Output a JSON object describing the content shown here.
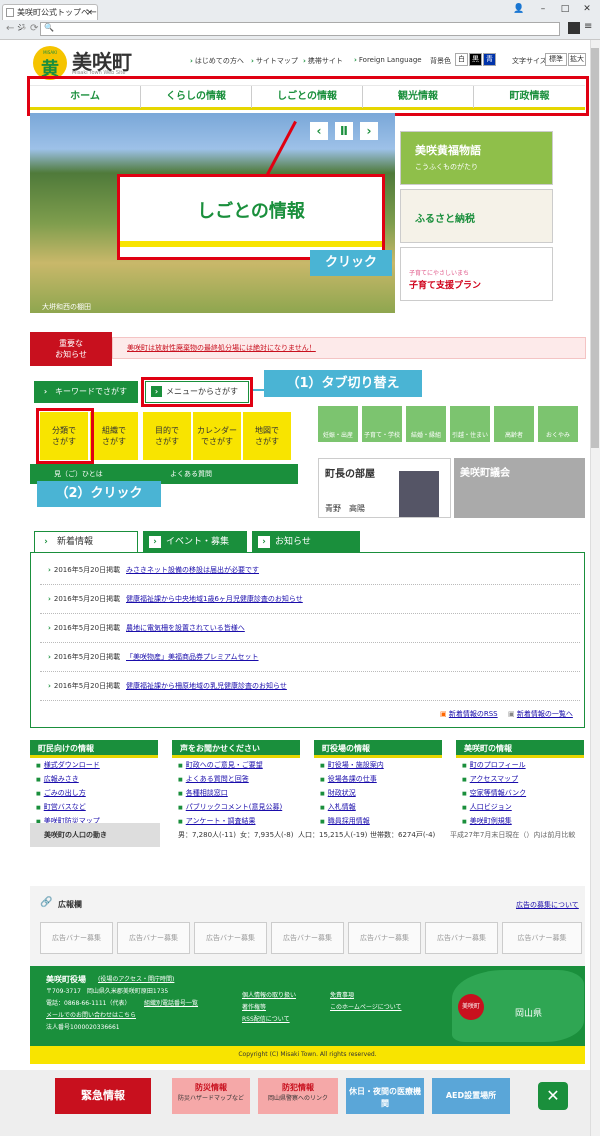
{
  "browser": {
    "tab_title": "美咲町公式トップページ",
    "address": ""
  },
  "header": {
    "logo_mark": "黄",
    "logo_mark_top": "MISAKI",
    "logo_title": "美咲町",
    "logo_sub": "Misaki Town Web Site",
    "util_links": [
      "はじめての方へ",
      "サイトマップ",
      "携帯サイト",
      "Foreign Language"
    ],
    "bg_label": "背景色",
    "bg_options": [
      "白",
      "黒",
      "青"
    ],
    "font_label": "文字サイズ",
    "font_options": [
      "標準",
      "拡大"
    ]
  },
  "gnav": [
    "ホーム",
    "くらしの情報",
    "しごとの情報",
    "観光情報",
    "町政情報"
  ],
  "hero": {
    "card_text": "しごとの情報",
    "caption": "大垪和西の棚田",
    "callout": "クリック"
  },
  "banners": [
    {
      "title": "美咲黄福物語",
      "sub": "こうふくものがたり"
    },
    {
      "title": "ふるさと納税",
      "sub": ""
    },
    {
      "title": "子育て支援プラン",
      "sub": "子育てにやさしいまち"
    }
  ],
  "news": {
    "label": "重要な\nお知らせ",
    "text": "美咲町は放射性廃棄物の最終処分場には絶対になりません！"
  },
  "search": {
    "tabs": [
      "キーワードでさがす",
      "メニューからさがす"
    ],
    "callout1": "（1）タブ切り替え",
    "callout2": "（2）クリック",
    "buttons": [
      [
        "分類で",
        "さがす"
      ],
      [
        "組織で",
        "さがす"
      ],
      [
        "目的で",
        "さがす"
      ],
      [
        "カレンダー",
        "でさがす"
      ],
      [
        "地図で",
        "さがす"
      ]
    ],
    "bar_left": "見（ご）ひとは",
    "bar_right": "よくある質問"
  },
  "life_icons": [
    "妊娠・出産",
    "子育て・学校",
    "結婚・縁組",
    "引越・住まい",
    "高齢者",
    "おくやみ"
  ],
  "promo": {
    "mayor": "町長の部屋",
    "mayor_name": "青野　高陽",
    "council": "美咲町議会"
  },
  "news_tabs": [
    "新着情報",
    "イベント・募集",
    "お知らせ"
  ],
  "news_items": [
    {
      "date": "2016年5月20日掲載",
      "title": "みさきネット設備の移設は届出が必要です"
    },
    {
      "date": "2016年5月20日掲載",
      "title": "健康福祉課から中央地域1歳6ヶ月児健康診査のお知らせ"
    },
    {
      "date": "2016年5月20日掲載",
      "title": "農地に電気柵を設置されている皆様へ"
    },
    {
      "date": "2016年5月20日掲載",
      "title": "「美咲物産」美福商品券プレミアムセット"
    },
    {
      "date": "2016年5月20日掲載",
      "title": "健康福祉課から柵原地域の乳児健康診査のお知らせ"
    }
  ],
  "news_footer": {
    "rss": "新着情報のRSS",
    "list": "新着情報の一覧へ"
  },
  "columns": [
    {
      "title": "町民向けの情報",
      "links": [
        "様式ダウンロード",
        "広報みさき",
        "ごみの出し方",
        "町営バスなど",
        "美咲町防災マップ"
      ]
    },
    {
      "title": "声をお聞かせください",
      "links": [
        "町政へのご意見・ご要望",
        "よくある質問と回答",
        "各種相談窓口",
        "パブリックコメント(意見公募)",
        "アンケート・調査結果"
      ]
    },
    {
      "title": "町役場の情報",
      "links": [
        "町役場・施設案内",
        "役場各課の仕事",
        "財政状況",
        "入札情報",
        "職員採用情報"
      ]
    },
    {
      "title": "美咲町の情報",
      "links": [
        "町のプロフィール",
        "アクセスマップ",
        "空家等情報バンク",
        "人口ビジョン",
        "美咲町例規集"
      ]
    }
  ],
  "population": {
    "label": "美咲町の人口の動き",
    "men": "男：7,280人(-11)",
    "women": "女：7,935人(-8)",
    "total": "人口：15,215人(-19)",
    "households": "世帯数：6274戸(-4)",
    "note": "平成27年7月末日現在（）内は前月比較"
  },
  "ads": {
    "label": "広報欄",
    "link": "広告の募集について",
    "slot": "広告バナー募集"
  },
  "footer": {
    "office": "美咲町役場",
    "office_link": "(役場のアクセス・開庁時間)",
    "address": "〒709-3717　岡山県久米郡美咲町原田1735",
    "tel": "電話：0868-66-1111（代表）",
    "dir": "組織別電話番号一覧",
    "mail": "メールでのお問い合わせはこちら",
    "corp": "法人番号1000020336661",
    "links_a": [
      "個人情報の取り扱い",
      "著作権等",
      "RSS配信について"
    ],
    "links_b": [
      "免責事項",
      "このホームページについて"
    ],
    "map_pin": "美咲町",
    "map_pref": "岡山県"
  },
  "copyright": "Copyright (C) Misaki Town. All rights reserved.",
  "emergency": {
    "main": "緊急情報",
    "items": [
      {
        "title": "防災情報",
        "sub": "防災ハザードマップなど"
      },
      {
        "title": "防犯情報",
        "sub": "岡山県警察へのリンク"
      },
      {
        "title": "休日・夜間の医療機関",
        "sub": ""
      },
      {
        "title": "AED設置場所",
        "sub": ""
      }
    ],
    "close": "✕"
  },
  "colors": {
    "green": "#1a8f3c",
    "yellow": "#f8e400",
    "red": "#c8101e",
    "callout": "#4ab4d4"
  }
}
